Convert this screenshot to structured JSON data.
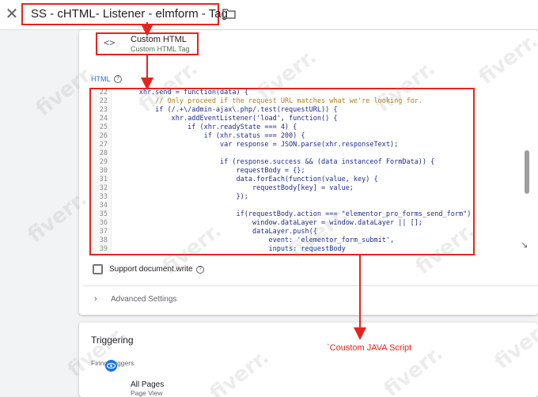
{
  "header": {
    "close_symbol": "✕",
    "tag_name": "SS - cHTML- Listener - elmform - Tag",
    "folder_icon": "folder-icon"
  },
  "tag_type": {
    "icon_glyph": "<>",
    "name": "Custom HTML",
    "subtitle": "Custom HTML Tag"
  },
  "html_section": {
    "label": "HTML",
    "help_symbol": "?"
  },
  "code": {
    "lines": [
      {
        "n": "22",
        "indent": 6,
        "text": "xhr.send = function(data) {",
        "kind": "code"
      },
      {
        "n": "22",
        "indent": 10,
        "text": "// Only proceed if the request URL matches what we're looking for.",
        "kind": "comment"
      },
      {
        "n": "23",
        "indent": 10,
        "text": "if (/.+\\/admin-ajax\\.php/.test(requestURL)) {",
        "kind": "code"
      },
      {
        "n": "24",
        "indent": 14,
        "text": "xhr.addEventListener('load', function() {",
        "kind": "code"
      },
      {
        "n": "25",
        "indent": 18,
        "text": "if (xhr.readyState === 4) {",
        "kind": "code"
      },
      {
        "n": "26",
        "indent": 22,
        "text": "if (xhr.status === 200) {",
        "kind": "code"
      },
      {
        "n": "27",
        "indent": 26,
        "text": "var response = JSON.parse(xhr.responseText);",
        "kind": "code"
      },
      {
        "n": "28",
        "indent": 0,
        "text": "",
        "kind": "code"
      },
      {
        "n": "29",
        "indent": 26,
        "text": "if (response.success && (data instanceof FormData)) {",
        "kind": "code"
      },
      {
        "n": "30",
        "indent": 30,
        "text": "requestBody = {};",
        "kind": "code"
      },
      {
        "n": "31",
        "indent": 30,
        "text": "data.forEach(function(value, key) {",
        "kind": "code"
      },
      {
        "n": "32",
        "indent": 34,
        "text": "requestBody[key] = value;",
        "kind": "code"
      },
      {
        "n": "33",
        "indent": 30,
        "text": "});",
        "kind": "code"
      },
      {
        "n": "34",
        "indent": 0,
        "text": "",
        "kind": "code"
      },
      {
        "n": "35",
        "indent": 30,
        "text": "if(requestBody.action === \"elementor_pro_forms_send_form\") {",
        "kind": "code"
      },
      {
        "n": "36",
        "indent": 34,
        "text": "window.dataLayer = window.dataLayer || [];",
        "kind": "code"
      },
      {
        "n": "37",
        "indent": 34,
        "text": "dataLayer.push({",
        "kind": "code"
      },
      {
        "n": "38",
        "indent": 38,
        "text": "event: 'elementor_form_submit',",
        "kind": "code"
      },
      {
        "n": "39",
        "indent": 38,
        "text": "inputs: requestBody",
        "kind": "code"
      }
    ]
  },
  "options": {
    "support_label": "Support document.write",
    "help_symbol": "?",
    "advanced_symbol": "›",
    "advanced_label": "Advanced Settings"
  },
  "triggering": {
    "title": "Triggering",
    "firing_label": "Firing Triggers",
    "trigger_name": "All Pages",
    "trigger_sub": "Page View",
    "trigger_icon": "eye-icon",
    "trigger_color": "#1a73e8"
  },
  "annotation": {
    "text": "`Coustom JAVA Script",
    "color": "#e8231c"
  },
  "watermark_text": "fiverr."
}
